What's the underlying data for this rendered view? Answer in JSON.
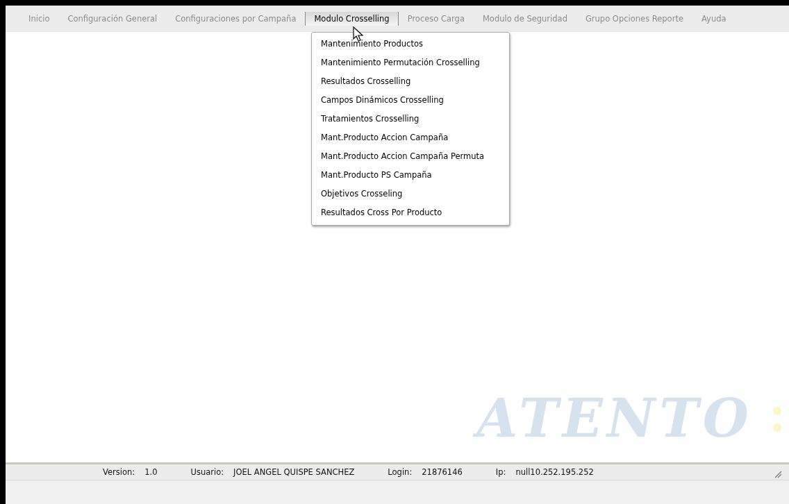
{
  "menu_bar": [
    {
      "label": "Inicio",
      "selected": false
    },
    {
      "label": "Configuración General",
      "selected": false
    },
    {
      "label": "Configuraciones por Campaña",
      "selected": false
    },
    {
      "label": "Modulo Crosselling",
      "selected": true
    },
    {
      "label": "Proceso Carga",
      "selected": false
    },
    {
      "label": "Modulo de Seguridad",
      "selected": false
    },
    {
      "label": "Grupo Opciones Reporte",
      "selected": false
    },
    {
      "label": "Ayuda",
      "selected": false
    }
  ],
  "dropdown": {
    "items": [
      "Mantenimiento Productos",
      "Mantenimiento Permutación Crosselling",
      "Resultados Crosselling",
      "Campos Dinámicos Crosselling",
      "Tratamientos Crosselling",
      "Mant.Producto Accion Campaña",
      "Mant.Producto Accion Campaña Permuta",
      "Mant.Producto PS Campaña",
      "Objetivos Crosseling",
      "Resultados Cross Por Producto"
    ]
  },
  "logo": {
    "text": "ATENTO"
  },
  "status_bar": [
    {
      "label": "Version:",
      "value": "1.0"
    },
    {
      "label": "Usuario:",
      "value": "JOEL ANGEL QUISPE SANCHEZ"
    },
    {
      "label": "Login:",
      "value": "21876146"
    },
    {
      "label": "Ip:",
      "value": "null10.252.195.252"
    }
  ]
}
